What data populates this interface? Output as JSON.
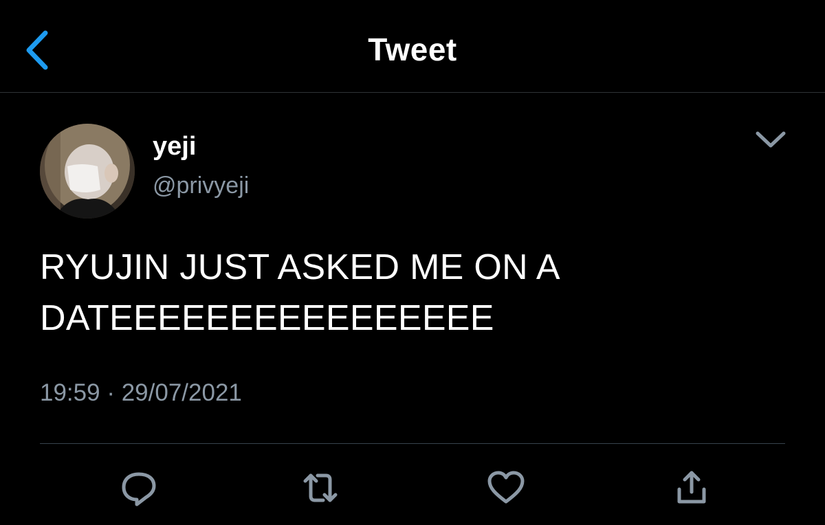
{
  "header": {
    "title": "Tweet",
    "back_icon": "chevron-left-icon"
  },
  "tweet": {
    "author": {
      "display_name": "yeji",
      "handle": "@privyeji"
    },
    "text_lines": [
      "RYUJIN JUST ASKED ME ON A",
      "DATEEEEEEEEEEEEEEEE"
    ],
    "time": "19:59",
    "separator": "·",
    "date": "29/07/2021",
    "menu_icon": "chevron-down-icon"
  },
  "actions": {
    "reply_icon": "reply-icon",
    "retweet_icon": "retweet-icon",
    "like_icon": "heart-icon",
    "share_icon": "share-icon"
  },
  "colors": {
    "background": "#000000",
    "text": "#ffffff",
    "secondary_text": "#8b98a5",
    "accent": "#1d9bf0",
    "divider": "#38444d"
  }
}
